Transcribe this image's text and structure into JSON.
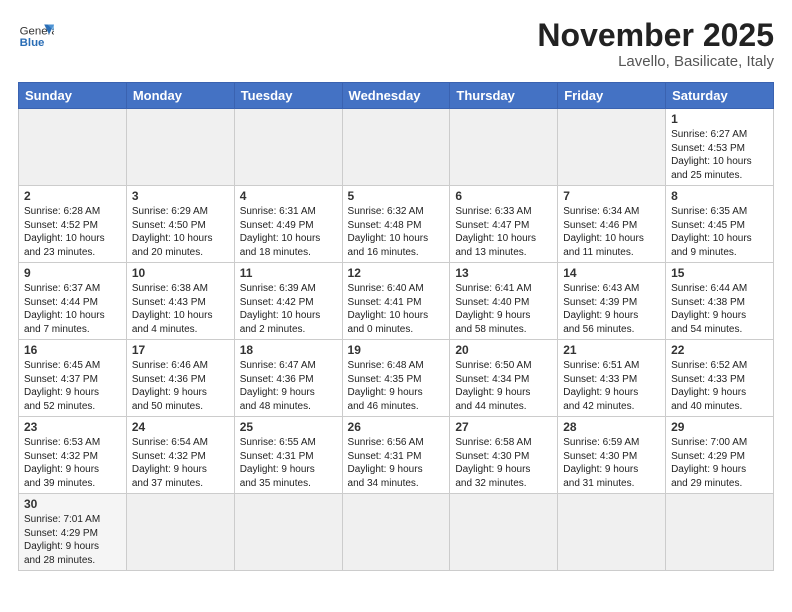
{
  "logo": {
    "general": "General",
    "blue": "Blue"
  },
  "title": "November 2025",
  "subtitle": "Lavello, Basilicate, Italy",
  "headers": [
    "Sunday",
    "Monday",
    "Tuesday",
    "Wednesday",
    "Thursday",
    "Friday",
    "Saturday"
  ],
  "weeks": [
    [
      {
        "num": "",
        "info": "",
        "empty": true
      },
      {
        "num": "",
        "info": "",
        "empty": true
      },
      {
        "num": "",
        "info": "",
        "empty": true
      },
      {
        "num": "",
        "info": "",
        "empty": true
      },
      {
        "num": "",
        "info": "",
        "empty": true
      },
      {
        "num": "",
        "info": "",
        "empty": true
      },
      {
        "num": "1",
        "info": "Sunrise: 6:27 AM\nSunset: 4:53 PM\nDaylight: 10 hours\nand 25 minutes."
      }
    ],
    [
      {
        "num": "2",
        "info": "Sunrise: 6:28 AM\nSunset: 4:52 PM\nDaylight: 10 hours\nand 23 minutes."
      },
      {
        "num": "3",
        "info": "Sunrise: 6:29 AM\nSunset: 4:50 PM\nDaylight: 10 hours\nand 20 minutes."
      },
      {
        "num": "4",
        "info": "Sunrise: 6:31 AM\nSunset: 4:49 PM\nDaylight: 10 hours\nand 18 minutes."
      },
      {
        "num": "5",
        "info": "Sunrise: 6:32 AM\nSunset: 4:48 PM\nDaylight: 10 hours\nand 16 minutes."
      },
      {
        "num": "6",
        "info": "Sunrise: 6:33 AM\nSunset: 4:47 PM\nDaylight: 10 hours\nand 13 minutes."
      },
      {
        "num": "7",
        "info": "Sunrise: 6:34 AM\nSunset: 4:46 PM\nDaylight: 10 hours\nand 11 minutes."
      },
      {
        "num": "8",
        "info": "Sunrise: 6:35 AM\nSunset: 4:45 PM\nDaylight: 10 hours\nand 9 minutes."
      }
    ],
    [
      {
        "num": "9",
        "info": "Sunrise: 6:37 AM\nSunset: 4:44 PM\nDaylight: 10 hours\nand 7 minutes."
      },
      {
        "num": "10",
        "info": "Sunrise: 6:38 AM\nSunset: 4:43 PM\nDaylight: 10 hours\nand 4 minutes."
      },
      {
        "num": "11",
        "info": "Sunrise: 6:39 AM\nSunset: 4:42 PM\nDaylight: 10 hours\nand 2 minutes."
      },
      {
        "num": "12",
        "info": "Sunrise: 6:40 AM\nSunset: 4:41 PM\nDaylight: 10 hours\nand 0 minutes."
      },
      {
        "num": "13",
        "info": "Sunrise: 6:41 AM\nSunset: 4:40 PM\nDaylight: 9 hours\nand 58 minutes."
      },
      {
        "num": "14",
        "info": "Sunrise: 6:43 AM\nSunset: 4:39 PM\nDaylight: 9 hours\nand 56 minutes."
      },
      {
        "num": "15",
        "info": "Sunrise: 6:44 AM\nSunset: 4:38 PM\nDaylight: 9 hours\nand 54 minutes."
      }
    ],
    [
      {
        "num": "16",
        "info": "Sunrise: 6:45 AM\nSunset: 4:37 PM\nDaylight: 9 hours\nand 52 minutes."
      },
      {
        "num": "17",
        "info": "Sunrise: 6:46 AM\nSunset: 4:36 PM\nDaylight: 9 hours\nand 50 minutes."
      },
      {
        "num": "18",
        "info": "Sunrise: 6:47 AM\nSunset: 4:36 PM\nDaylight: 9 hours\nand 48 minutes."
      },
      {
        "num": "19",
        "info": "Sunrise: 6:48 AM\nSunset: 4:35 PM\nDaylight: 9 hours\nand 46 minutes."
      },
      {
        "num": "20",
        "info": "Sunrise: 6:50 AM\nSunset: 4:34 PM\nDaylight: 9 hours\nand 44 minutes."
      },
      {
        "num": "21",
        "info": "Sunrise: 6:51 AM\nSunset: 4:33 PM\nDaylight: 9 hours\nand 42 minutes."
      },
      {
        "num": "22",
        "info": "Sunrise: 6:52 AM\nSunset: 4:33 PM\nDaylight: 9 hours\nand 40 minutes."
      }
    ],
    [
      {
        "num": "23",
        "info": "Sunrise: 6:53 AM\nSunset: 4:32 PM\nDaylight: 9 hours\nand 39 minutes."
      },
      {
        "num": "24",
        "info": "Sunrise: 6:54 AM\nSunset: 4:32 PM\nDaylight: 9 hours\nand 37 minutes."
      },
      {
        "num": "25",
        "info": "Sunrise: 6:55 AM\nSunset: 4:31 PM\nDaylight: 9 hours\nand 35 minutes."
      },
      {
        "num": "26",
        "info": "Sunrise: 6:56 AM\nSunset: 4:31 PM\nDaylight: 9 hours\nand 34 minutes."
      },
      {
        "num": "27",
        "info": "Sunrise: 6:58 AM\nSunset: 4:30 PM\nDaylight: 9 hours\nand 32 minutes."
      },
      {
        "num": "28",
        "info": "Sunrise: 6:59 AM\nSunset: 4:30 PM\nDaylight: 9 hours\nand 31 minutes."
      },
      {
        "num": "29",
        "info": "Sunrise: 7:00 AM\nSunset: 4:29 PM\nDaylight: 9 hours\nand 29 minutes."
      }
    ],
    [
      {
        "num": "30",
        "info": "Sunrise: 7:01 AM\nSunset: 4:29 PM\nDaylight: 9 hours\nand 28 minutes."
      },
      {
        "num": "",
        "info": "",
        "empty": true
      },
      {
        "num": "",
        "info": "",
        "empty": true
      },
      {
        "num": "",
        "info": "",
        "empty": true
      },
      {
        "num": "",
        "info": "",
        "empty": true
      },
      {
        "num": "",
        "info": "",
        "empty": true
      },
      {
        "num": "",
        "info": "",
        "empty": true
      }
    ]
  ]
}
